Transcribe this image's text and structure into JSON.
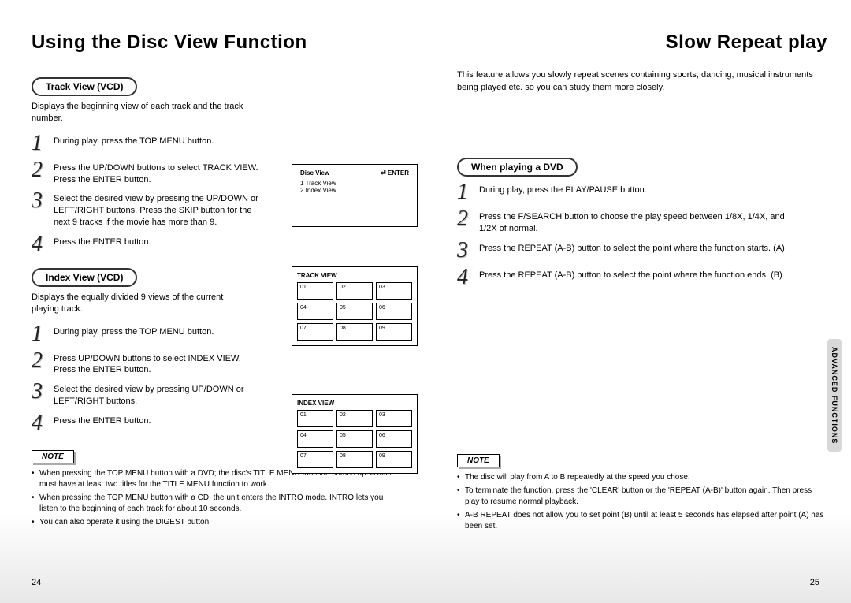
{
  "left": {
    "title": "Using the Disc View Function",
    "track": {
      "pill": "Track View (VCD)",
      "desc": "Displays the beginning view of each track and the track number.",
      "steps": [
        "During play, press the TOP MENU button.",
        "Press the UP/DOWN buttons to select TRACK VIEW. Press the ENTER button.",
        "Select the desired view by pressing the UP/DOWN or LEFT/RIGHT buttons. Press the SKIP button for the next 9 tracks if the movie has more than 9.",
        "Press the ENTER button."
      ]
    },
    "index": {
      "pill": "Index View (VCD)",
      "desc": "Displays the equally divided 9 views of the current playing track.",
      "steps": [
        "During play, press the TOP MENU button.",
        "Press UP/DOWN buttons to select INDEX VIEW. Press the ENTER button.",
        "Select the desired view by pressing UP/DOWN or LEFT/RIGHT buttons.",
        "Press the ENTER button."
      ]
    },
    "note_label": "NOTE",
    "notes": [
      "When pressing the TOP MENU button with a DVD; the disc's TITLE MENU function comes up. A disc must have at least two titles for the TITLE MENU function to work.",
      "When pressing the TOP MENU button with a CD; the unit enters the INTRO mode. INTRO lets you listen to the beginning of each track for about 10 seconds.",
      "You can also operate it using the DIGEST button."
    ],
    "osd1": {
      "title": "Disc View",
      "enter": "ENTER",
      "line1": "1 Track View",
      "line2": "2 Index View"
    },
    "osd2": {
      "title": "TRACK VIEW",
      "cells": [
        "01",
        "02",
        "03",
        "04",
        "05",
        "06",
        "07",
        "08",
        "09"
      ]
    },
    "osd3": {
      "title": "INDEX VIEW",
      "cells": [
        "01",
        "02",
        "03",
        "04",
        "05",
        "06",
        "07",
        "08",
        "09"
      ]
    },
    "pagenum": "24"
  },
  "right": {
    "title": "Slow Repeat play",
    "intro": "This feature allows you slowly repeat scenes containing sports, dancing, musical instruments being played etc. so you can study them more closely.",
    "section_pill": "When playing a DVD",
    "steps": [
      "During play, press the PLAY/PAUSE button.",
      "Press the F/SEARCH button to choose the play speed between 1/8X, 1/4X, and 1/2X of normal.",
      "Press the REPEAT (A-B) button to select the point where the function starts. (A)",
      "Press the REPEAT (A-B) button to select the point where the function ends. (B)"
    ],
    "note_label": "NOTE",
    "notes": [
      "The disc will play from A to B repeatedly at the speed you chose.",
      "To terminate the function, press the 'CLEAR' button or the 'REPEAT (A-B)' button again. Then press play to resume normal playback.",
      "A-B REPEAT does not allow you to set point (B) until at least 5 seconds has elapsed after point (A) has been set."
    ],
    "sidetab": "ADVANCED FUNCTIONS",
    "pagenum": "25"
  }
}
